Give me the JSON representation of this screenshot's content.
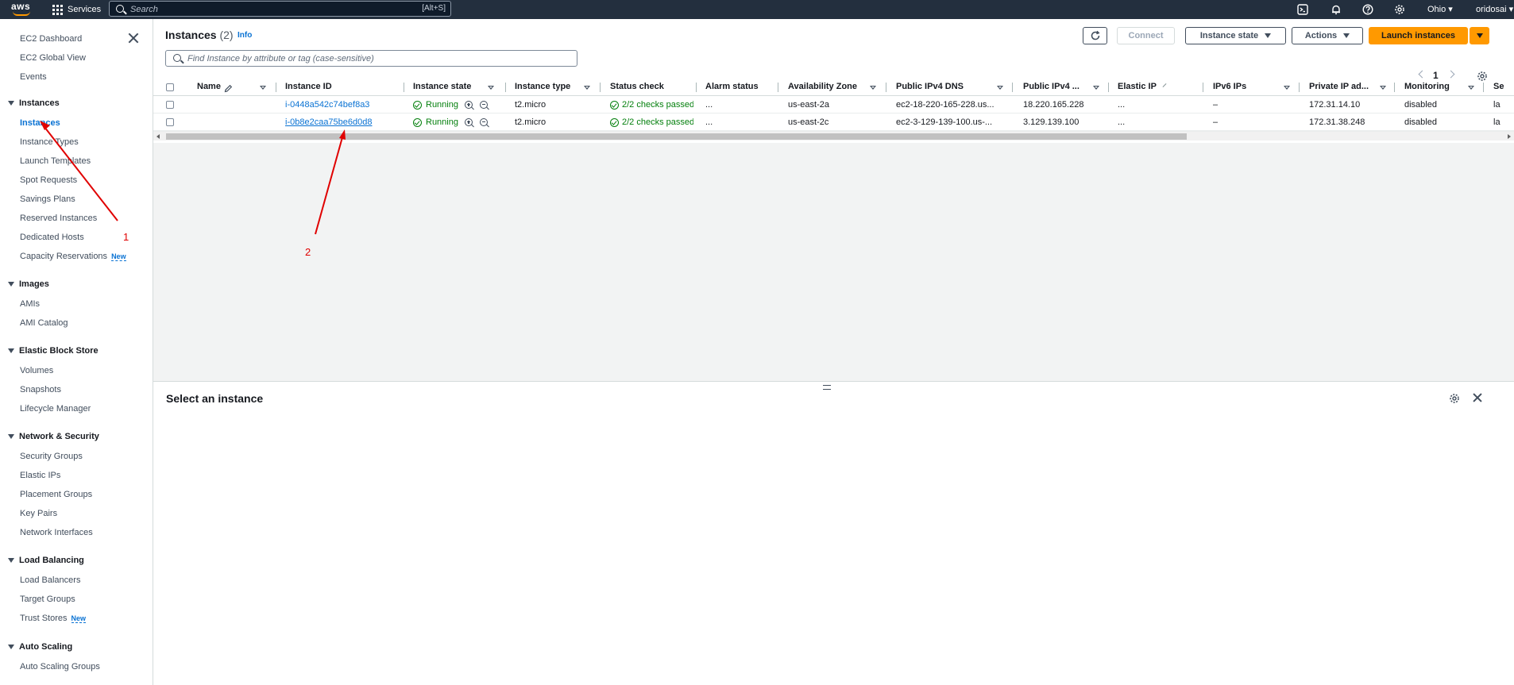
{
  "topbar": {
    "logo_text": "aws",
    "services_label": "Services",
    "search_placeholder": "Search",
    "search_shortcut": "[Alt+S]",
    "region": "Ohio ▾",
    "account": "oridosai ▾"
  },
  "sidebar": {
    "top_links": [
      "EC2 Dashboard",
      "EC2 Global View",
      "Events"
    ],
    "sections": [
      {
        "title": "Instances",
        "items": [
          "Instances",
          "Instance Types",
          "Launch Templates",
          "Spot Requests",
          "Savings Plans",
          "Reserved Instances",
          "Dedicated Hosts",
          "Capacity Reservations"
        ]
      },
      {
        "title": "Images",
        "items": [
          "AMIs",
          "AMI Catalog"
        ]
      },
      {
        "title": "Elastic Block Store",
        "items": [
          "Volumes",
          "Snapshots",
          "Lifecycle Manager"
        ]
      },
      {
        "title": "Network & Security",
        "items": [
          "Security Groups",
          "Elastic IPs",
          "Placement Groups",
          "Key Pairs",
          "Network Interfaces"
        ]
      },
      {
        "title": "Load Balancing",
        "items": [
          "Load Balancers",
          "Target Groups",
          "Trust Stores"
        ]
      },
      {
        "title": "Auto Scaling",
        "items": [
          "Auto Scaling Groups"
        ]
      }
    ],
    "new_badge": "New",
    "active_item": "Instances"
  },
  "panel": {
    "title": "Instances",
    "count": "(2)",
    "info": "Info",
    "filter_placeholder": "Find Instance by attribute or tag (case-sensitive)",
    "buttons": {
      "connect": "Connect",
      "instance_state": "Instance state",
      "actions": "Actions",
      "launch": "Launch instances"
    },
    "page": "1"
  },
  "table": {
    "columns": [
      "Name",
      "Instance ID",
      "Instance state",
      "Instance type",
      "Status check",
      "Alarm status",
      "Availability Zone",
      "Public IPv4 DNS",
      "Public IPv4 ...",
      "Elastic IP",
      "IPv6 IPs",
      "Private IP ad...",
      "Monitoring",
      "Se"
    ],
    "rows": [
      {
        "name": "",
        "id": "i-0448a542c74bef8a3",
        "state": "Running",
        "type": "t2.micro",
        "status": "2/2 checks passed",
        "alarm": "...",
        "az": "us-east-2a",
        "dns": "ec2-18-220-165-228.us...",
        "ipv4": "18.220.165.228",
        "eip": "...",
        "ipv6": "–",
        "private": "172.31.14.10",
        "monitoring": "disabled",
        "extra": "la"
      },
      {
        "name": "",
        "id": "i-0b8e2caa75be6d0d8",
        "state": "Running",
        "type": "t2.micro",
        "status": "2/2 checks passed",
        "alarm": "...",
        "az": "us-east-2c",
        "dns": "ec2-3-129-139-100.us-...",
        "ipv4": "3.129.139.100",
        "eip": "...",
        "ipv6": "–",
        "private": "172.31.38.248",
        "monitoring": "disabled",
        "extra": "la"
      }
    ]
  },
  "details": {
    "title": "Select an instance"
  },
  "annotations": {
    "label_1": "1",
    "label_2": "2",
    "color": "#e00000"
  },
  "colors": {
    "topbar": "#232f3e",
    "link": "#0972d3",
    "primary": "#ff9900",
    "success": "#037f0c"
  }
}
